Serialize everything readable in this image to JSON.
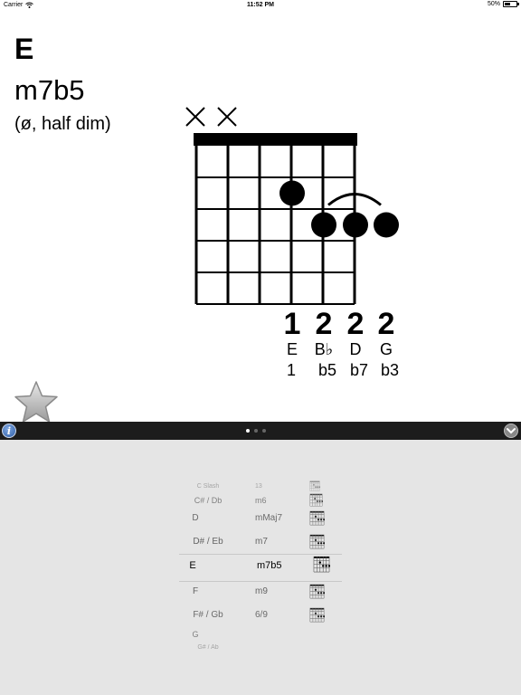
{
  "status_bar": {
    "carrier": "Carrier",
    "time": "11:52 PM",
    "battery_text": "50%",
    "battery_level": 0.5
  },
  "chord": {
    "root": "E",
    "quality": "m7b5",
    "alias": "(ø, half dim)",
    "muted_strings": [
      1,
      2
    ],
    "fingers": [
      {
        "string": 4,
        "fret": 2,
        "finger": "1",
        "note": "E",
        "interval": "1"
      },
      {
        "string": 5,
        "fret": 3,
        "finger": "2",
        "note": "B♭",
        "interval": "b5"
      },
      {
        "string": 6,
        "fret": 3,
        "finger": "2",
        "note": "D",
        "interval": "b7"
      },
      {
        "string": 7,
        "fret": 3,
        "finger": "2",
        "note": "G",
        "interval": "b3"
      }
    ]
  },
  "toolbar": {
    "info_label": "i",
    "page_count": 3,
    "active_page": 0
  },
  "picker": {
    "rows": [
      {
        "root": "C Slash",
        "quality": "13",
        "size": 7,
        "opacity": 0.45
      },
      {
        "root": "C# / Db",
        "quality": "m6",
        "size": 9,
        "opacity": 0.7
      },
      {
        "root": "D",
        "quality": "mMaj7",
        "size": 10,
        "opacity": 0.85
      },
      {
        "root": "D# / Eb",
        "quality": "m7",
        "size": 10,
        "opacity": 0.9
      },
      {
        "root": "E",
        "quality": "m7b5",
        "size": 11,
        "opacity": 1,
        "selected": true
      },
      {
        "root": "F",
        "quality": "m9",
        "size": 10,
        "opacity": 0.9
      },
      {
        "root": "F# / Gb",
        "quality": "6/9",
        "size": 10,
        "opacity": 0.85
      },
      {
        "root": "G",
        "quality": "",
        "size": 9,
        "opacity": 0.7
      },
      {
        "root": "G# / Ab",
        "quality": "",
        "size": 7,
        "opacity": 0.45
      }
    ]
  }
}
